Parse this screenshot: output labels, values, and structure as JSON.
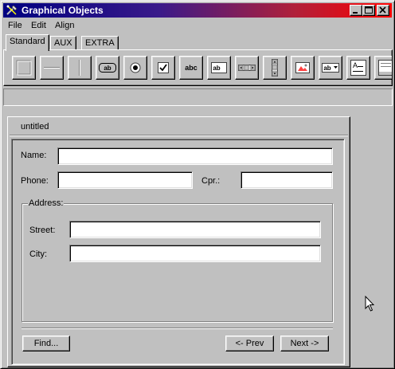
{
  "window": {
    "title": "Graphical Objects",
    "app_icon": "tools-icon"
  },
  "titlebar_buttons": [
    {
      "name": "minimize-button",
      "icon": "minimize-icon"
    },
    {
      "name": "maximize-button",
      "icon": "maximize-icon"
    },
    {
      "name": "close-button",
      "icon": "close-icon"
    }
  ],
  "menu": {
    "file": "File",
    "edit": "Edit",
    "align": "Align"
  },
  "palette_tabs": {
    "standard": "Standard",
    "aux": "AUX",
    "extra": "EXTRA",
    "selected": "Standard"
  },
  "toolbar": {
    "tools": [
      "rectangle-tool-icon",
      "horizontal-line-tool-icon",
      "vertical-line-tool-icon",
      "button-tool-icon",
      "radio-button-tool-icon",
      "checkbox-tool-icon",
      "static-text-tool-icon",
      "text-field-tool-icon",
      "horizontal-scrollbar-tool-icon",
      "vertical-scrollbar-tool-icon",
      "picture-tool-icon",
      "combo-box-tool-icon",
      "memo-tool-icon",
      "list-view-tool-icon"
    ],
    "button_text": "ab",
    "static_text": "abc",
    "field_text": "ab",
    "combo_text": "ab",
    "memo_text": "A"
  },
  "document": {
    "tab_title": "untitled",
    "form": {
      "name_label": "Name:",
      "name_value": "",
      "phone_label": "Phone:",
      "phone_value": "",
      "cpr_label": "Cpr.:",
      "cpr_value": "",
      "address_group": "Address:",
      "street_label": "Street:",
      "street_value": "",
      "city_label": "City:",
      "city_value": "",
      "find_button": "Find...",
      "prev_button": "<- Prev",
      "next_button": "Next ->"
    }
  },
  "colors": {
    "face": "#c0c0c0",
    "title_start": "#000080",
    "title_end": "#ff0000"
  }
}
